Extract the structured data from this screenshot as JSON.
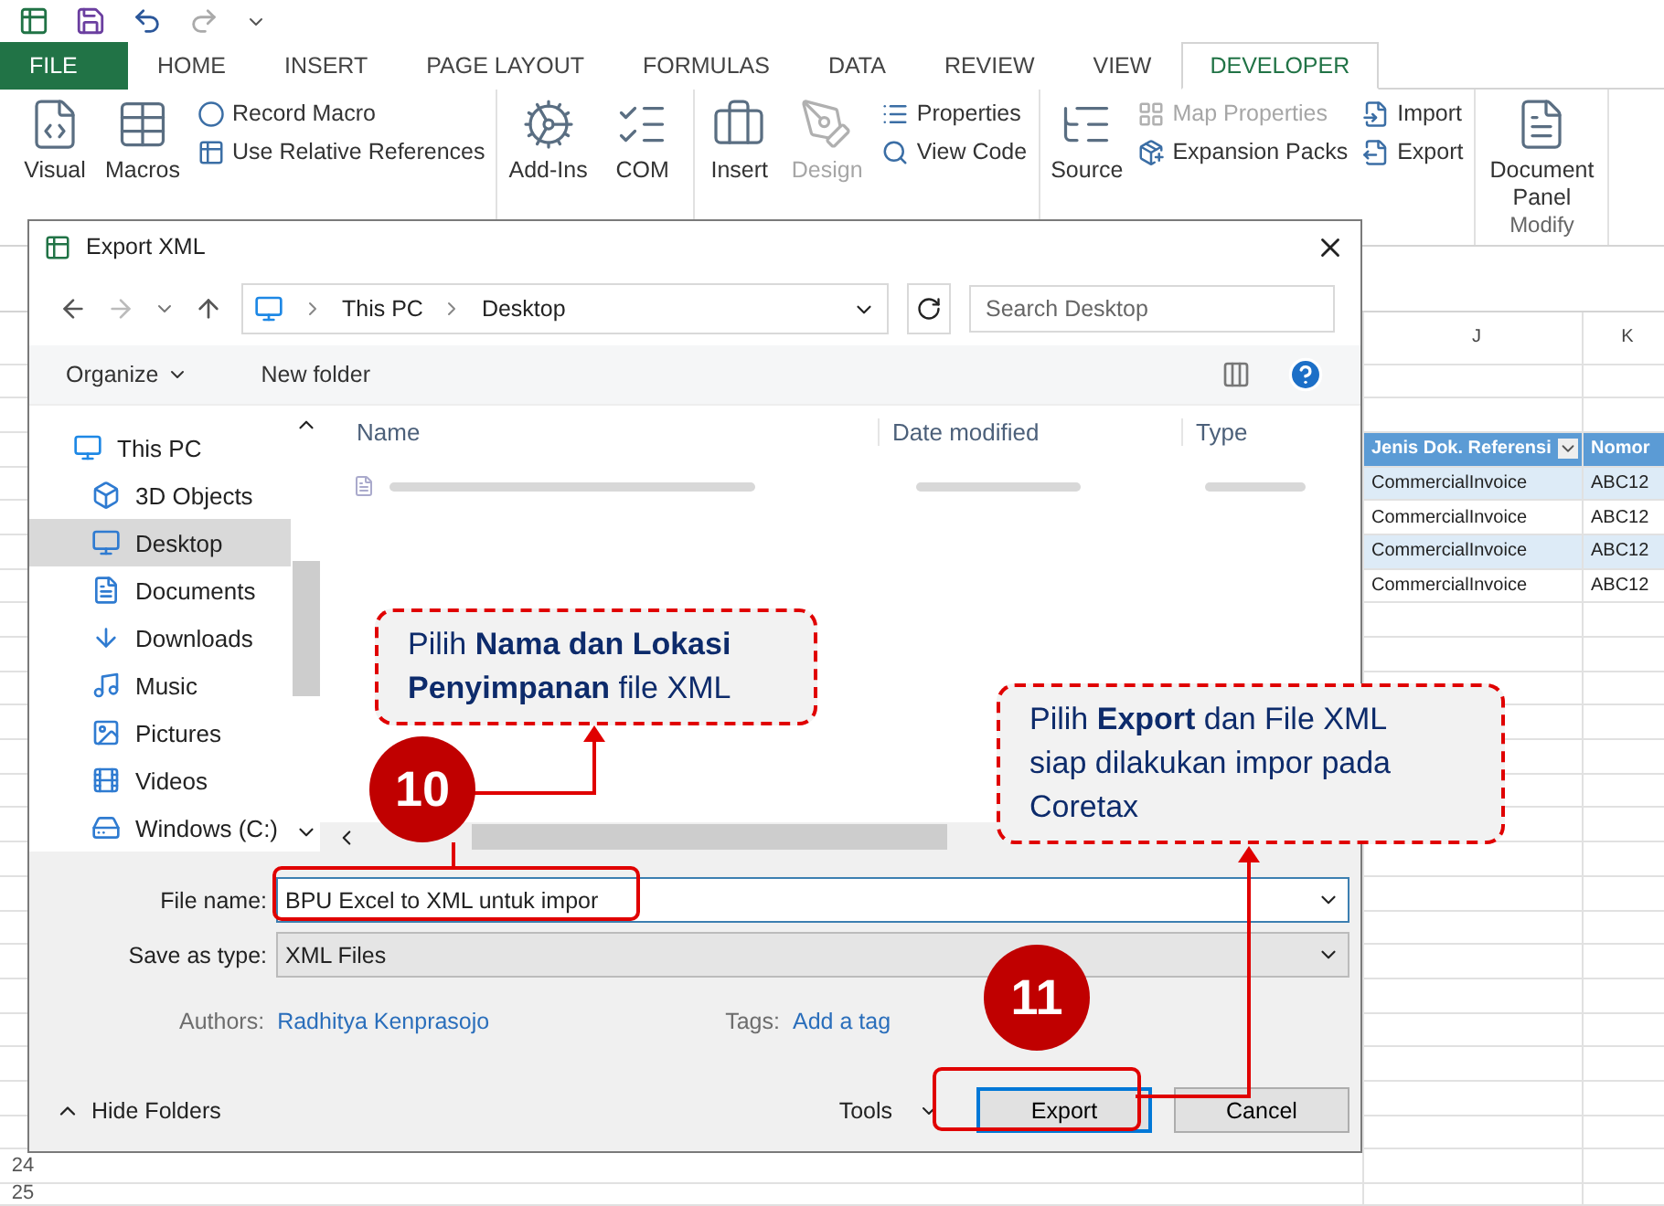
{
  "excel": {
    "ribbon_tabs": [
      {
        "label": "FILE",
        "kind": "file",
        "selected": false
      },
      {
        "label": "HOME",
        "kind": "tab",
        "selected": false
      },
      {
        "label": "INSERT",
        "kind": "tab",
        "selected": false
      },
      {
        "label": "PAGE LAYOUT",
        "kind": "tab",
        "selected": false
      },
      {
        "label": "FORMULAS",
        "kind": "tab",
        "selected": false
      },
      {
        "label": "DATA",
        "kind": "tab",
        "selected": false
      },
      {
        "label": "REVIEW",
        "kind": "tab",
        "selected": false
      },
      {
        "label": "VIEW",
        "kind": "tab",
        "selected": false
      },
      {
        "label": "DEVELOPER",
        "kind": "tab",
        "selected": true
      }
    ],
    "ribbon_groups": [
      {
        "items": [
          {
            "label": "Visual",
            "kind": "large",
            "disabled": false
          },
          {
            "label": "Macros",
            "kind": "large",
            "disabled": false
          },
          {
            "label": "Record Macro",
            "kind": "small",
            "disabled": false
          },
          {
            "label": "Use Relative References",
            "kind": "small",
            "disabled": false
          }
        ]
      },
      {
        "items": [
          {
            "label": "Add-Ins",
            "kind": "large",
            "disabled": false
          },
          {
            "label": "COM",
            "kind": "large",
            "disabled": false
          }
        ]
      },
      {
        "items": [
          {
            "label": "Insert",
            "kind": "large",
            "disabled": false
          },
          {
            "label": "Design",
            "kind": "large",
            "disabled": true
          },
          {
            "label": "Properties",
            "kind": "small",
            "disabled": false
          },
          {
            "label": "View Code",
            "kind": "small",
            "disabled": false
          }
        ]
      },
      {
        "items": [
          {
            "label": "Source",
            "kind": "large",
            "disabled": false
          },
          {
            "label": "Map Properties",
            "kind": "small",
            "disabled": true
          },
          {
            "label": "Expansion Packs",
            "kind": "small",
            "disabled": false
          },
          {
            "label": "Import",
            "kind": "small",
            "disabled": false
          },
          {
            "label": "Export",
            "kind": "small",
            "disabled": false
          }
        ]
      },
      {
        "label": "Modify",
        "items": [
          {
            "label": "Document Panel",
            "kind": "large",
            "disabled": false
          }
        ]
      }
    ]
  },
  "sheet": {
    "column_headers": [
      "J",
      "K"
    ],
    "table": {
      "columns": [
        "Jenis Dok. Referensi",
        "Nomor"
      ],
      "rows": [
        [
          "CommercialInvoice",
          "ABC12"
        ],
        [
          "CommercialInvoice",
          "ABC12"
        ],
        [
          "CommercialInvoice",
          "ABC12"
        ],
        [
          "CommercialInvoice",
          "ABC12"
        ]
      ]
    },
    "row_numbers": [
      "24",
      "25"
    ]
  },
  "dialog": {
    "title": "Export XML",
    "breadcrumb": [
      "This PC",
      "Desktop"
    ],
    "search": {
      "placeholder": "Search Desktop"
    },
    "toolbar": {
      "organize": "Organize",
      "new_folder": "New folder"
    },
    "nav_tree": [
      {
        "label": "This PC",
        "selected": false,
        "children": [
          {
            "label": "3D Objects",
            "selected": false
          },
          {
            "label": "Desktop",
            "selected": true
          },
          {
            "label": "Documents",
            "selected": false
          },
          {
            "label": "Downloads",
            "selected": false
          },
          {
            "label": "Music",
            "selected": false
          },
          {
            "label": "Pictures",
            "selected": false
          },
          {
            "label": "Videos",
            "selected": false
          },
          {
            "label": "Windows (C:)",
            "selected": false
          }
        ]
      }
    ],
    "file_columns": [
      "Name",
      "Date modified",
      "Type"
    ],
    "file_name": {
      "label": "File name:",
      "value": "BPU Excel to XML untuk impor"
    },
    "save_as_type": {
      "label": "Save as type:",
      "value": "XML Files"
    },
    "authors": {
      "label": "Authors:",
      "value": "Radhitya Kenprasojo"
    },
    "tags": {
      "label": "Tags:",
      "value": "Add a tag"
    },
    "hide_folders": "Hide Folders",
    "tools": "Tools",
    "export_button": "Export",
    "cancel_button": "Cancel"
  },
  "callouts": [
    "Pilih **Nama dan Lokasi Penyimpanan** file XML",
    "Pilih **Export** dan File XML siap dilakukan impor pada Coretax"
  ],
  "step_badges": [
    "10",
    "11"
  ]
}
